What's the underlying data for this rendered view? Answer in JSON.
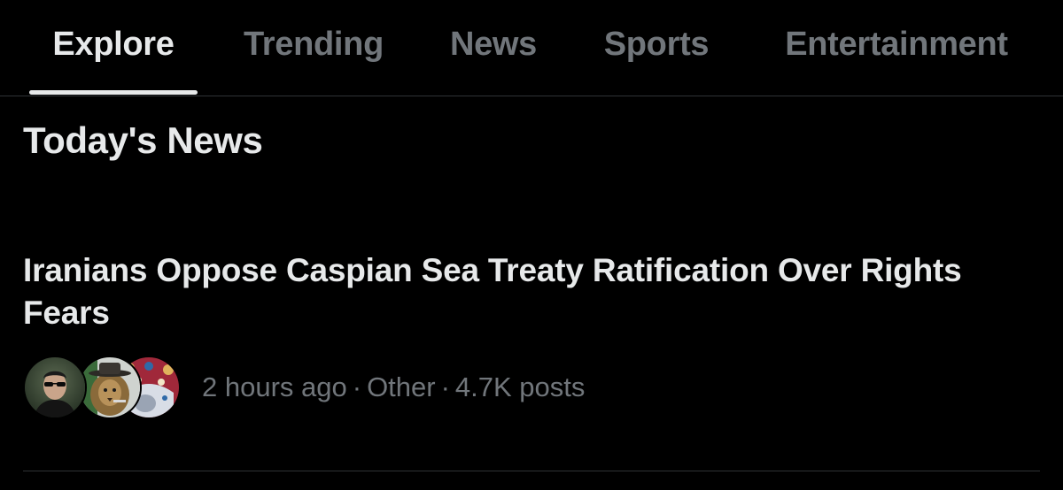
{
  "tabs": [
    {
      "label": "Explore",
      "active": true
    },
    {
      "label": "Trending",
      "active": false
    },
    {
      "label": "News",
      "active": false
    },
    {
      "label": "Sports",
      "active": false
    },
    {
      "label": "Entertainment",
      "active": false
    }
  ],
  "section": {
    "title": "Today's News"
  },
  "news_item": {
    "headline": "Iranians Oppose Caspian Sea Treaty Ratification Over Rights Fears",
    "time": "2 hours ago",
    "category": "Other",
    "post_count": "4.7K posts",
    "separator": "·",
    "avatars": [
      {
        "icon": "avatar-person-sunglasses-icon"
      },
      {
        "icon": "avatar-lion-hat-icon"
      },
      {
        "icon": "avatar-ornate-pattern-icon"
      }
    ]
  },
  "colors": {
    "background": "#000000",
    "primary_text": "#e7e9ea",
    "secondary_text": "#71767b",
    "divider": "#2f3336"
  }
}
